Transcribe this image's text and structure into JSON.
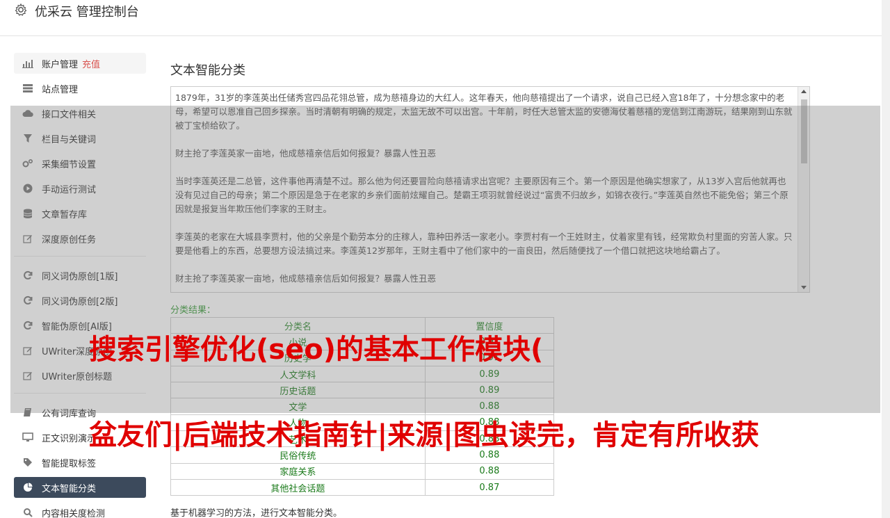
{
  "header": {
    "title": "优采云 管理控制台",
    "icon": "gear-icon"
  },
  "sidebar": {
    "group1": [
      {
        "label": "账户管理",
        "tag": "充值",
        "icon": "bar-chart-icon"
      },
      {
        "label": "站点管理",
        "icon": "server-icon"
      },
      {
        "label": "接口文件相关",
        "icon": "cloud-upload-icon"
      },
      {
        "label": "栏目与关键词",
        "icon": "filter-icon"
      },
      {
        "label": "采集细节设置",
        "icon": "cogs-icon"
      },
      {
        "label": "手动运行测试",
        "icon": "play-circle-icon"
      },
      {
        "label": "文章暂存库",
        "icon": "database-icon"
      },
      {
        "label": "深度原创任务",
        "icon": "edit-icon"
      }
    ],
    "group2": [
      {
        "label": "同义词伪原创[1版]",
        "icon": "refresh-icon"
      },
      {
        "label": "同义词伪原创[2版]",
        "icon": "refresh-icon"
      },
      {
        "label": "智能伪原创[AI版]",
        "icon": "refresh-icon"
      },
      {
        "label": "UWriter深度原创",
        "icon": "edit-icon"
      },
      {
        "label": "UWriter原创标题",
        "icon": "edit-icon"
      }
    ],
    "group3": [
      {
        "label": "公有词库查询",
        "icon": "book-icon"
      },
      {
        "label": "正文识别演示",
        "icon": "monitor-icon"
      },
      {
        "label": "智能提取标签",
        "icon": "tag-icon"
      },
      {
        "label": "文本智能分类",
        "icon": "pie-chart-icon",
        "active": true
      },
      {
        "label": "内容相关度检测",
        "icon": "search-icon"
      }
    ]
  },
  "main": {
    "title": "文本智能分类",
    "input_text": [
      "1879年，31岁的李莲英出任储秀宫四品花翎总管，成为慈禧身边的大红人。这年春天，他向慈禧提出了一个请求，说自己已经入宫18年了，十分想念家中的老母，希望可以恩准自己回乡探亲。当时清朝有明确的规定，太监无故不可以出宫。十年前，时任大总管太监的安德海仗着慈禧的宠信到江南游玩，结果刚到山东就被丁宝桢给砍了。",
      "财主抢了李莲英家一亩地，他成慈禧亲信后如何报复？暴露人性丑恶",
      "当时李莲英还是二总管，这件事他再清楚不过。那么他为何还要冒险向慈禧请求出宫呢？主要原因有三个。第一个原因是他确实想家了，从13岁入宫后他就再也没有见过自己的母亲；第二个原因是急于在老家的乡亲们面前炫耀自己。楚霸王项羽就曾经说过“富贵不归故乡，如锦衣夜行。”李莲英自然也不能免俗；第三个原因就是报复当年欺压他们李家的王财主。",
      "李莲英的老家在大城县李贾村，他的父亲是个勤劳本分的庄稼人，靠种田养活一家老小。李贾村有一个王姓财主，仗着家里有钱，经常欺负村里面的穷苦人家。只要是他看上的东西，总要想方设法搞过来。李莲英12岁那年，王财主看中了他们家中的一亩良田，然后随便找了一个借口就把这块地给霸占了。",
      "财主抢了李莲英家一亩地，他成慈禧亲信后如何报复？暴露人性丑恶"
    ],
    "result_label": "分类结果：",
    "table": {
      "headers": [
        "分类名",
        "置信度"
      ],
      "rows": [
        [
          "小说",
          "0.91"
        ],
        [
          "历史学",
          "0.91"
        ],
        [
          "人文学科",
          "0.89"
        ],
        [
          "历史话题",
          "0.89"
        ],
        [
          "文学",
          "0.88"
        ],
        [
          "人物",
          "0.88"
        ],
        [
          "艺术",
          "0.88"
        ],
        [
          "民俗传统",
          "0.88"
        ],
        [
          "家庭关系",
          "0.88"
        ],
        [
          "其他社会话题",
          "0.87"
        ]
      ]
    },
    "footnote": "基于机器学习的方法，进行文本智能分类。"
  },
  "watermark": {
    "line1": "搜索引擎优化(seo)的基本工作模块(",
    "line2": "盆友们|后端技术指南针|来源|图虫读完，肯定有所收获"
  }
}
